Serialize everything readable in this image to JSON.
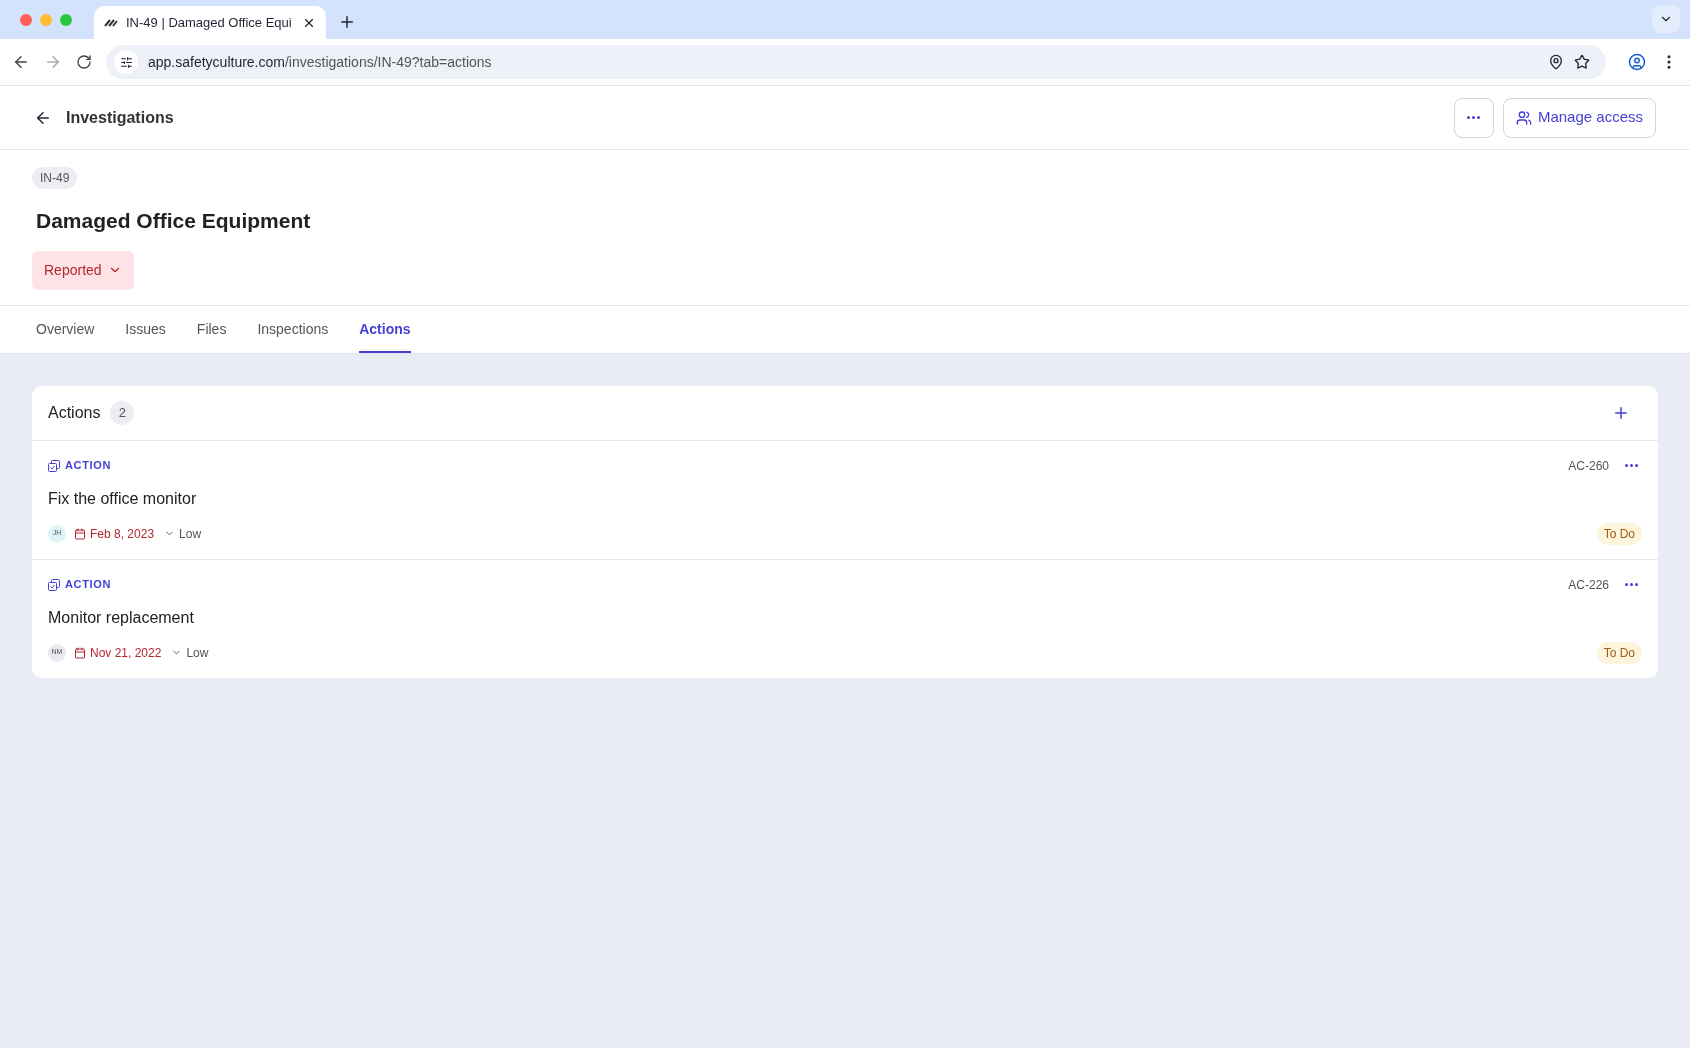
{
  "browser": {
    "tab_title": "IN-49 | Damaged Office Equi",
    "url_domain": "app.safetyculture.com",
    "url_path": "/investigations/IN-49?tab=actions"
  },
  "header": {
    "back_label": "Investigations",
    "manage_access": "Manage access"
  },
  "investigation": {
    "id": "IN-49",
    "title": "Damaged Office Equipment",
    "status": "Reported"
  },
  "tabs": [
    {
      "label": "Overview",
      "selected": false
    },
    {
      "label": "Issues",
      "selected": false
    },
    {
      "label": "Files",
      "selected": false
    },
    {
      "label": "Inspections",
      "selected": false
    },
    {
      "label": "Actions",
      "selected": true
    }
  ],
  "actions_panel": {
    "title": "Actions",
    "count": "2",
    "items": [
      {
        "type_label": "ACTION",
        "code": "AC-260",
        "title": "Fix the office monitor",
        "assignee": "JH",
        "color": "#dff4f8",
        "due": "Feb 8, 2023",
        "priority": "Low",
        "status": "To Do"
      },
      {
        "type_label": "ACTION",
        "code": "AC-226",
        "title": "Monitor replacement",
        "assignee": "NM",
        "color": "#e8eaf0",
        "due": "Nov 21, 2022",
        "priority": "Low",
        "status": "To Do"
      }
    ]
  }
}
